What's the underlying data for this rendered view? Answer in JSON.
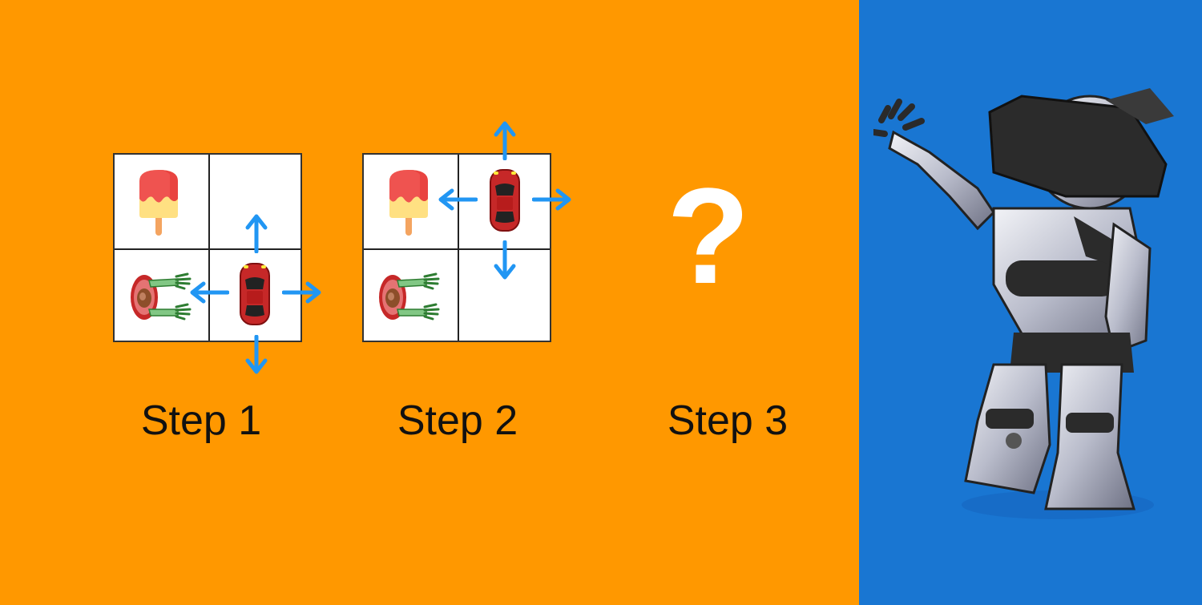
{
  "steps": [
    {
      "label": "Step 1"
    },
    {
      "label": "Step 2"
    },
    {
      "label": "Step 3"
    }
  ],
  "unknown_symbol": "?",
  "colors": {
    "left_background": "#FF9800",
    "right_background": "#1976D2",
    "arrow": "#2196F3",
    "car": "#C62828",
    "grid_line": "#222222",
    "label_text": "#111111",
    "question_mark": "#FFFFFF"
  },
  "icons": [
    "ice-pop-icon",
    "zombie-icon",
    "car-icon",
    "arrow-up-icon",
    "arrow-down-icon",
    "arrow-left-icon",
    "arrow-right-icon",
    "robot-vr-headset-image"
  ]
}
